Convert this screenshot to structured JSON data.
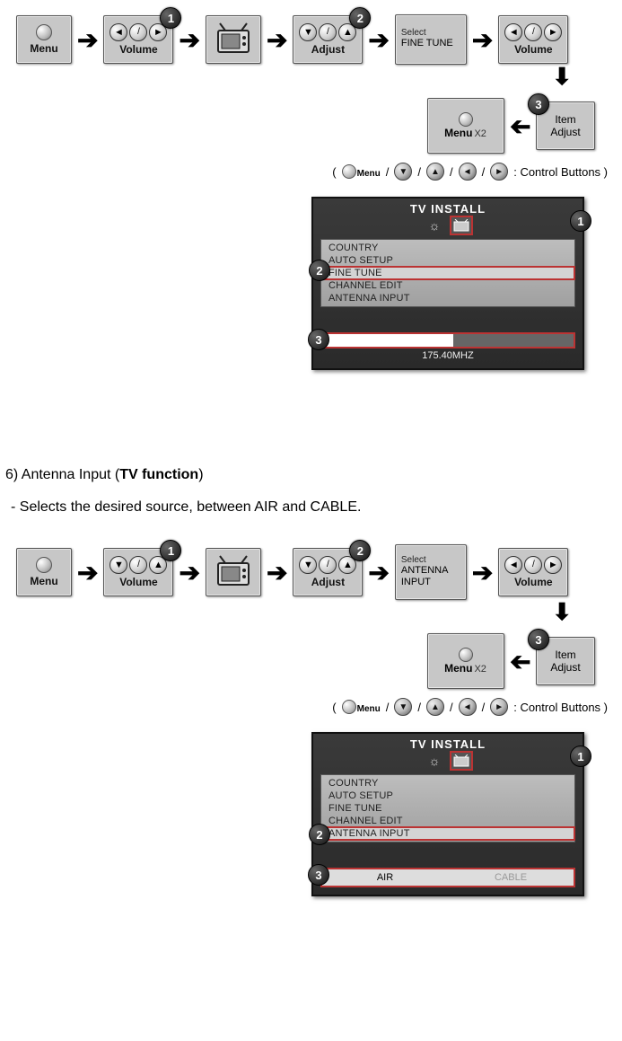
{
  "buttons": {
    "menu": "Menu",
    "volume": "Volume",
    "adjust": "Adjust",
    "menu_x2": "Menu",
    "menu_x2_suffix": "X2",
    "item": "Item",
    "adjust2": "Adjust",
    "select_label": "Select"
  },
  "steps": {
    "s1": "1",
    "s2": "2",
    "s3": "3"
  },
  "fine_tune_flow": {
    "select_value": "FINE TUNE"
  },
  "antenna_flow": {
    "select_value": "ANTENNA\nINPUT"
  },
  "legend": {
    "text": ": Control Buttons )",
    "open": "(",
    "slash": "/"
  },
  "osd": {
    "title": "TV  INSTALL",
    "items": [
      "COUNTRY",
      "AUTO SETUP",
      "FINE TUNE",
      "CHANNEL EDIT",
      "ANTENNA INPUT"
    ],
    "fine_tune_value": "175.40MHZ",
    "antenna_options": [
      "AIR",
      "CABLE"
    ]
  },
  "section6": {
    "heading_prefix": "6) Antenna Input (",
    "heading_bold": "TV function",
    "heading_suffix": ")",
    "description": " - Selects the desired source, between AIR and CABLE."
  }
}
